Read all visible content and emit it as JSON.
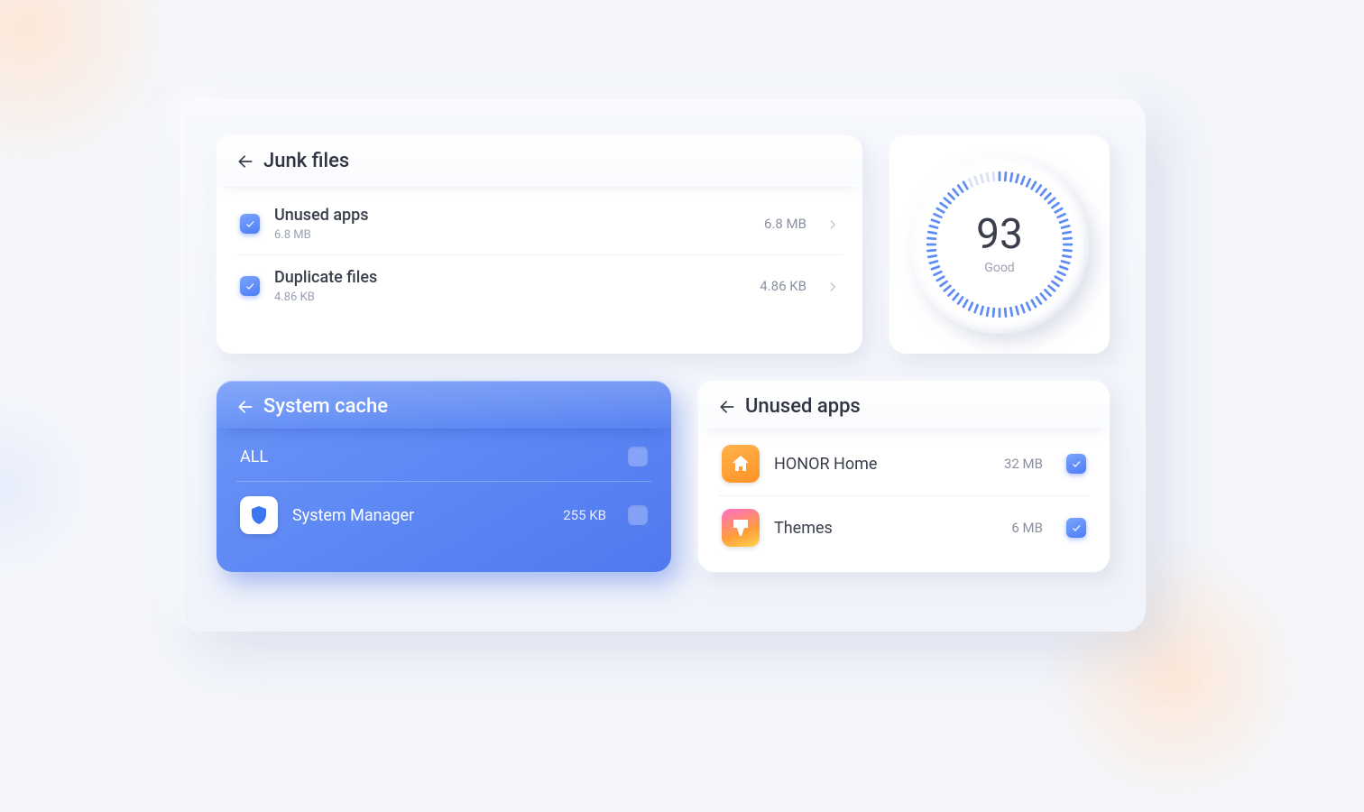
{
  "junk": {
    "title": "Junk files",
    "items": [
      {
        "title": "Unused apps",
        "sub": "6.8 MB",
        "size": "6.8 MB"
      },
      {
        "title": "Duplicate files",
        "sub": "4.86 KB",
        "size": "4.86 KB"
      }
    ]
  },
  "score": {
    "value": "93",
    "label": "Good"
  },
  "cache": {
    "title": "System cache",
    "all_label": "ALL",
    "items": [
      {
        "icon": "shield",
        "name": "System Manager",
        "size": "255 KB"
      }
    ]
  },
  "apps": {
    "title": "Unused apps",
    "items": [
      {
        "icon": "home",
        "name": "HONOR Home",
        "size": "32 MB"
      },
      {
        "icon": "themes",
        "name": "Themes",
        "size": "6 MB"
      }
    ]
  }
}
